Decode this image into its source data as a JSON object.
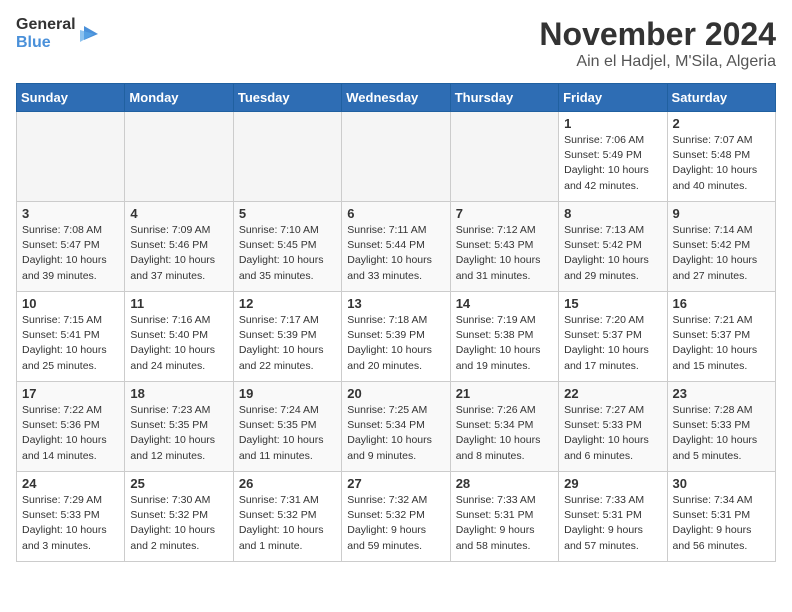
{
  "header": {
    "logo_line1": "General",
    "logo_line2": "Blue",
    "month": "November 2024",
    "location": "Ain el Hadjel, M'Sila, Algeria"
  },
  "days_of_week": [
    "Sunday",
    "Monday",
    "Tuesday",
    "Wednesday",
    "Thursday",
    "Friday",
    "Saturday"
  ],
  "weeks": [
    [
      {
        "day": "",
        "info": ""
      },
      {
        "day": "",
        "info": ""
      },
      {
        "day": "",
        "info": ""
      },
      {
        "day": "",
        "info": ""
      },
      {
        "day": "",
        "info": ""
      },
      {
        "day": "1",
        "info": "Sunrise: 7:06 AM\nSunset: 5:49 PM\nDaylight: 10 hours and 42 minutes."
      },
      {
        "day": "2",
        "info": "Sunrise: 7:07 AM\nSunset: 5:48 PM\nDaylight: 10 hours and 40 minutes."
      }
    ],
    [
      {
        "day": "3",
        "info": "Sunrise: 7:08 AM\nSunset: 5:47 PM\nDaylight: 10 hours and 39 minutes."
      },
      {
        "day": "4",
        "info": "Sunrise: 7:09 AM\nSunset: 5:46 PM\nDaylight: 10 hours and 37 minutes."
      },
      {
        "day": "5",
        "info": "Sunrise: 7:10 AM\nSunset: 5:45 PM\nDaylight: 10 hours and 35 minutes."
      },
      {
        "day": "6",
        "info": "Sunrise: 7:11 AM\nSunset: 5:44 PM\nDaylight: 10 hours and 33 minutes."
      },
      {
        "day": "7",
        "info": "Sunrise: 7:12 AM\nSunset: 5:43 PM\nDaylight: 10 hours and 31 minutes."
      },
      {
        "day": "8",
        "info": "Sunrise: 7:13 AM\nSunset: 5:42 PM\nDaylight: 10 hours and 29 minutes."
      },
      {
        "day": "9",
        "info": "Sunrise: 7:14 AM\nSunset: 5:42 PM\nDaylight: 10 hours and 27 minutes."
      }
    ],
    [
      {
        "day": "10",
        "info": "Sunrise: 7:15 AM\nSunset: 5:41 PM\nDaylight: 10 hours and 25 minutes."
      },
      {
        "day": "11",
        "info": "Sunrise: 7:16 AM\nSunset: 5:40 PM\nDaylight: 10 hours and 24 minutes."
      },
      {
        "day": "12",
        "info": "Sunrise: 7:17 AM\nSunset: 5:39 PM\nDaylight: 10 hours and 22 minutes."
      },
      {
        "day": "13",
        "info": "Sunrise: 7:18 AM\nSunset: 5:39 PM\nDaylight: 10 hours and 20 minutes."
      },
      {
        "day": "14",
        "info": "Sunrise: 7:19 AM\nSunset: 5:38 PM\nDaylight: 10 hours and 19 minutes."
      },
      {
        "day": "15",
        "info": "Sunrise: 7:20 AM\nSunset: 5:37 PM\nDaylight: 10 hours and 17 minutes."
      },
      {
        "day": "16",
        "info": "Sunrise: 7:21 AM\nSunset: 5:37 PM\nDaylight: 10 hours and 15 minutes."
      }
    ],
    [
      {
        "day": "17",
        "info": "Sunrise: 7:22 AM\nSunset: 5:36 PM\nDaylight: 10 hours and 14 minutes."
      },
      {
        "day": "18",
        "info": "Sunrise: 7:23 AM\nSunset: 5:35 PM\nDaylight: 10 hours and 12 minutes."
      },
      {
        "day": "19",
        "info": "Sunrise: 7:24 AM\nSunset: 5:35 PM\nDaylight: 10 hours and 11 minutes."
      },
      {
        "day": "20",
        "info": "Sunrise: 7:25 AM\nSunset: 5:34 PM\nDaylight: 10 hours and 9 minutes."
      },
      {
        "day": "21",
        "info": "Sunrise: 7:26 AM\nSunset: 5:34 PM\nDaylight: 10 hours and 8 minutes."
      },
      {
        "day": "22",
        "info": "Sunrise: 7:27 AM\nSunset: 5:33 PM\nDaylight: 10 hours and 6 minutes."
      },
      {
        "day": "23",
        "info": "Sunrise: 7:28 AM\nSunset: 5:33 PM\nDaylight: 10 hours and 5 minutes."
      }
    ],
    [
      {
        "day": "24",
        "info": "Sunrise: 7:29 AM\nSunset: 5:33 PM\nDaylight: 10 hours and 3 minutes."
      },
      {
        "day": "25",
        "info": "Sunrise: 7:30 AM\nSunset: 5:32 PM\nDaylight: 10 hours and 2 minutes."
      },
      {
        "day": "26",
        "info": "Sunrise: 7:31 AM\nSunset: 5:32 PM\nDaylight: 10 hours and 1 minute."
      },
      {
        "day": "27",
        "info": "Sunrise: 7:32 AM\nSunset: 5:32 PM\nDaylight: 9 hours and 59 minutes."
      },
      {
        "day": "28",
        "info": "Sunrise: 7:33 AM\nSunset: 5:31 PM\nDaylight: 9 hours and 58 minutes."
      },
      {
        "day": "29",
        "info": "Sunrise: 7:33 AM\nSunset: 5:31 PM\nDaylight: 9 hours and 57 minutes."
      },
      {
        "day": "30",
        "info": "Sunrise: 7:34 AM\nSunset: 5:31 PM\nDaylight: 9 hours and 56 minutes."
      }
    ]
  ]
}
